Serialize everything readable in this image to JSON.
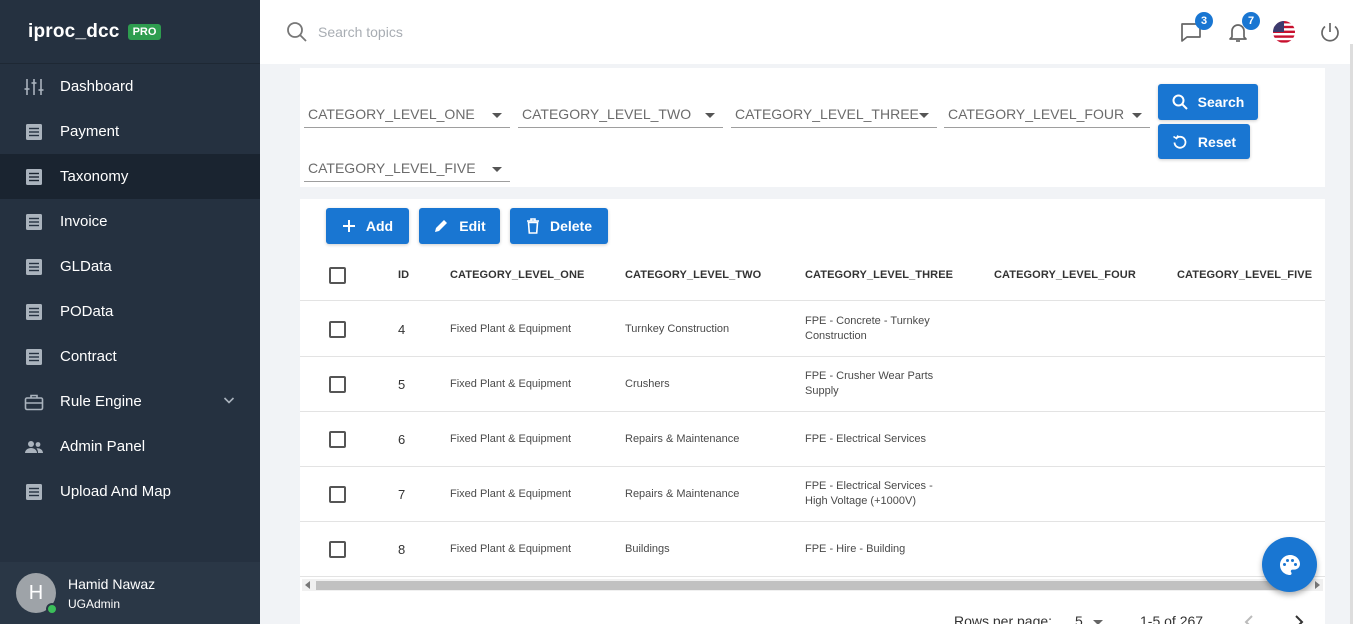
{
  "brand": {
    "name": "iproc_dcc",
    "badge": "PRO"
  },
  "sidebar": {
    "items": [
      {
        "label": "Dashboard",
        "icon": "sliders-icon"
      },
      {
        "label": "Payment",
        "icon": "list-icon"
      },
      {
        "label": "Taxonomy",
        "icon": "list-icon",
        "active": true
      },
      {
        "label": "Invoice",
        "icon": "list-icon"
      },
      {
        "label": "GLData",
        "icon": "list-icon"
      },
      {
        "label": "POData",
        "icon": "list-icon"
      },
      {
        "label": "Contract",
        "icon": "list-icon"
      },
      {
        "label": "Rule Engine",
        "icon": "briefcase-icon",
        "expandable": true
      },
      {
        "label": "Admin Panel",
        "icon": "people-icon"
      },
      {
        "label": "Upload And Map",
        "icon": "list-icon"
      }
    ],
    "user": {
      "initial": "H",
      "name": "Hamid Nawaz",
      "role": "UGAdmin"
    }
  },
  "topbar": {
    "search_placeholder": "Search topics",
    "messages_count": "3",
    "notifications_count": "7",
    "icons": [
      "chat-icon",
      "bell-icon",
      "us-flag-icon",
      "power-icon"
    ]
  },
  "filters": {
    "level_one": "CATEGORY_LEVEL_ONE",
    "level_two": "CATEGORY_LEVEL_TWO",
    "level_three": "CATEGORY_LEVEL_THREE",
    "level_four": "CATEGORY_LEVEL_FOUR",
    "level_five": "CATEGORY_LEVEL_FIVE",
    "search_label": "Search",
    "reset_label": "Reset"
  },
  "toolbar": {
    "add_label": "Add",
    "edit_label": "Edit",
    "delete_label": "Delete"
  },
  "table": {
    "columns": [
      "ID",
      "CATEGORY_LEVEL_ONE",
      "CATEGORY_LEVEL_TWO",
      "CATEGORY_LEVEL_THREE",
      "CATEGORY_LEVEL_FOUR",
      "CATEGORY_LEVEL_FIVE"
    ],
    "rows": [
      {
        "id": "4",
        "one": "Fixed Plant & Equipment",
        "two": "Turnkey Construction",
        "three_a": "FPE - Concrete - Turnkey",
        "three_b": "Construction"
      },
      {
        "id": "5",
        "one": "Fixed Plant & Equipment",
        "two": "Crushers",
        "three_a": "FPE - Crusher Wear Parts",
        "three_b": "Supply"
      },
      {
        "id": "6",
        "one": "Fixed Plant & Equipment",
        "two": "Repairs & Maintenance",
        "three_a": "FPE - Electrical Services",
        "three_b": ""
      },
      {
        "id": "7",
        "one": "Fixed Plant & Equipment",
        "two": "Repairs & Maintenance",
        "three_a": "FPE - Electrical Services -",
        "three_b": "High Voltage (+1000V)"
      },
      {
        "id": "8",
        "one": "Fixed Plant & Equipment",
        "two": "Buildings",
        "three_a": "FPE - Hire - Building",
        "three_b": ""
      }
    ]
  },
  "pagination": {
    "rows_per_page_label": "Rows per page:",
    "rows_per_page": "5",
    "range": "1-5 of 267"
  },
  "colors": {
    "sidebar": "#253140",
    "accent": "#1976d2",
    "pro_badge": "#2e9d4f"
  }
}
